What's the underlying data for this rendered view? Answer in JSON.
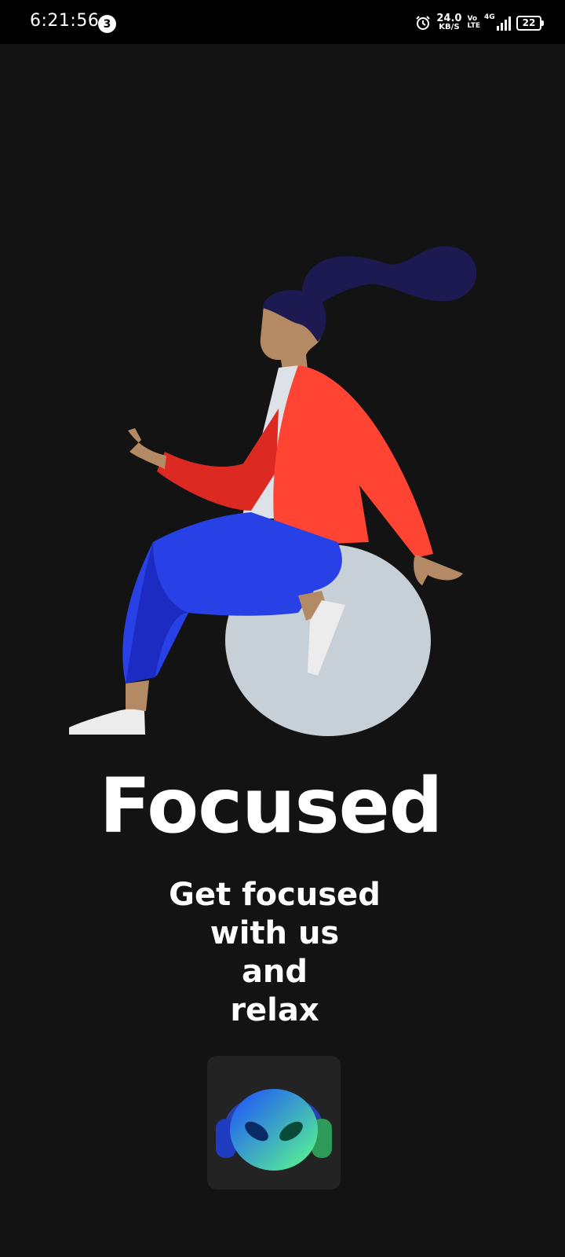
{
  "status_bar": {
    "time": "6:21:56",
    "notification_count": "3",
    "net_speed_value": "24.0",
    "net_speed_unit": "KB/S",
    "volte_top": "Vo",
    "volte_bottom": "LTE",
    "network": "4G",
    "battery": "22",
    "icons": [
      "alarm-icon",
      "volte-icon",
      "signal-icon",
      "battery-icon"
    ]
  },
  "illustration": {
    "icon": "woman-on-exercise-ball-illustration",
    "colors": {
      "hair": "#1d1a52",
      "skin": "#b38a63",
      "jacket": "#ff4433",
      "jacket_shadow": "#dc2a22",
      "shirt": "#dde1e8",
      "pants": "#2741e6",
      "pants_shadow": "#1c2cc2",
      "ball": "#c7d0d7",
      "shoes": "#ececec"
    }
  },
  "main": {
    "title": "Focused",
    "subtitle_lines": [
      "Get focused",
      "with us",
      "and",
      "relax"
    ]
  },
  "app_icon": {
    "icon": "alien-headphones-logo-icon",
    "colors": {
      "start": "#1b4cff",
      "end": "#5cff8a"
    }
  },
  "theme": {
    "background": "#131313",
    "status_bar_bg": "#000000",
    "text": "#ffffff"
  }
}
